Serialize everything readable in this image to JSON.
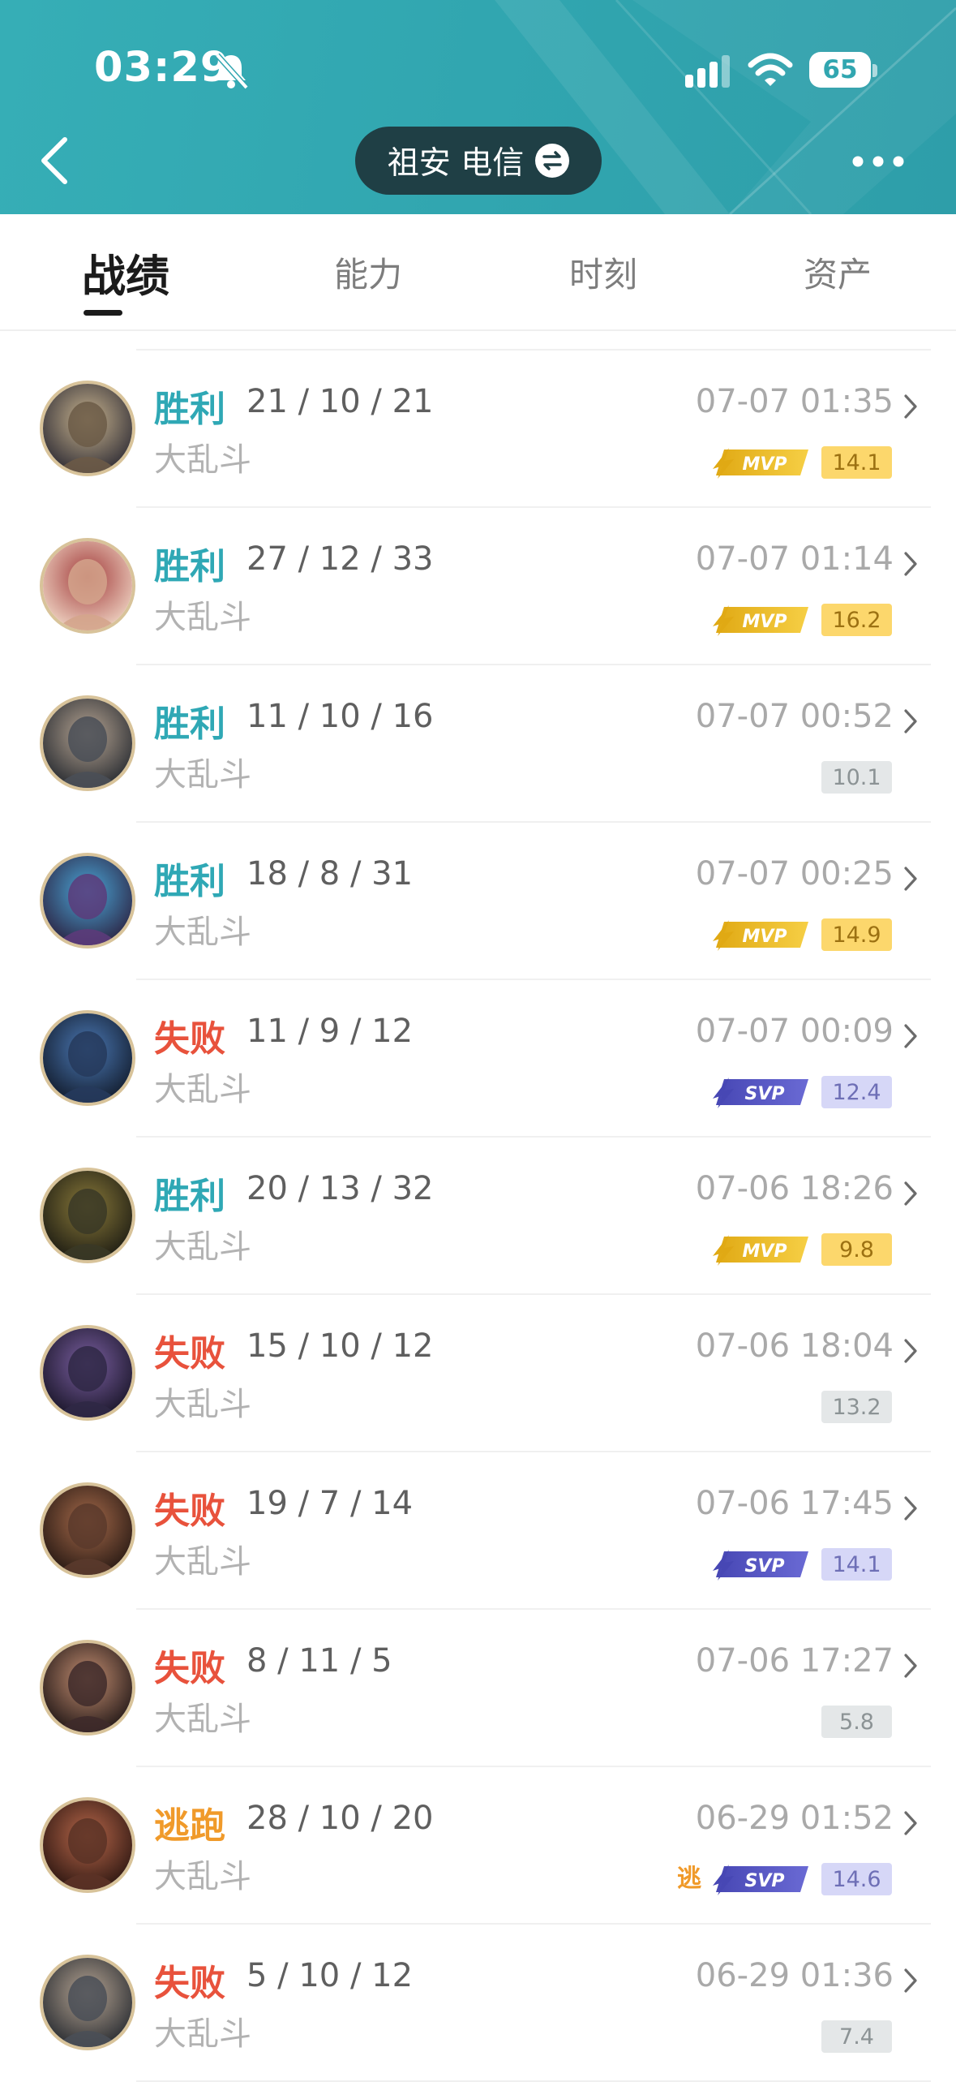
{
  "status_bar": {
    "time": "03:29",
    "battery": "65",
    "icons": [
      "bell-muted-icon",
      "signal-icon",
      "wifi-icon",
      "battery-icon"
    ]
  },
  "nav": {
    "server": "祖安 电信",
    "icons": [
      "back-icon",
      "swap-icon",
      "more-icon"
    ]
  },
  "tabs": [
    {
      "label": "战绩",
      "active": true
    },
    {
      "label": "能力",
      "active": false
    },
    {
      "label": "时刻",
      "active": false
    },
    {
      "label": "资产",
      "active": false
    }
  ],
  "colors": {
    "header": "#31a6b0",
    "win": "#2fa8b5",
    "loss": "#e8523c",
    "flee": "#f09a2a",
    "mvp": "#f2c230",
    "svp": "#5b5bc8"
  },
  "matches": [
    {
      "result": "胜利",
      "kda": "21 / 10 / 21",
      "mode": "大乱斗",
      "time": "07-07 01:35",
      "badge": "MVP",
      "score": "14.1"
    },
    {
      "result": "胜利",
      "kda": "27 / 12 / 33",
      "mode": "大乱斗",
      "time": "07-07 01:14",
      "badge": "MVP",
      "score": "16.2"
    },
    {
      "result": "胜利",
      "kda": "11 / 10 / 16",
      "mode": "大乱斗",
      "time": "07-07 00:52",
      "badge": "",
      "score": "10.1"
    },
    {
      "result": "胜利",
      "kda": "18 / 8 / 31",
      "mode": "大乱斗",
      "time": "07-07 00:25",
      "badge": "MVP",
      "score": "14.9"
    },
    {
      "result": "失败",
      "kda": "11 / 9 / 12",
      "mode": "大乱斗",
      "time": "07-07 00:09",
      "badge": "SVP",
      "score": "12.4"
    },
    {
      "result": "胜利",
      "kda": "20 / 13 / 32",
      "mode": "大乱斗",
      "time": "07-06 18:26",
      "badge": "MVP",
      "score": "9.8"
    },
    {
      "result": "失败",
      "kda": "15 / 10 / 12",
      "mode": "大乱斗",
      "time": "07-06 18:04",
      "badge": "",
      "score": "13.2"
    },
    {
      "result": "失败",
      "kda": "19 / 7 / 14",
      "mode": "大乱斗",
      "time": "07-06 17:45",
      "badge": "SVP",
      "score": "14.1"
    },
    {
      "result": "失败",
      "kda": "8 / 11 / 5",
      "mode": "大乱斗",
      "time": "07-06 17:27",
      "badge": "",
      "score": "5.8"
    },
    {
      "result": "逃跑",
      "kda": "28 / 10 / 20",
      "mode": "大乱斗",
      "time": "06-29 01:52",
      "badge": "SVP",
      "score": "14.6",
      "flee_icon": "逃"
    },
    {
      "result": "失败",
      "kda": "5 / 10 / 12",
      "mode": "大乱斗",
      "time": "06-29 01:36",
      "badge": "",
      "score": "7.4"
    }
  ]
}
